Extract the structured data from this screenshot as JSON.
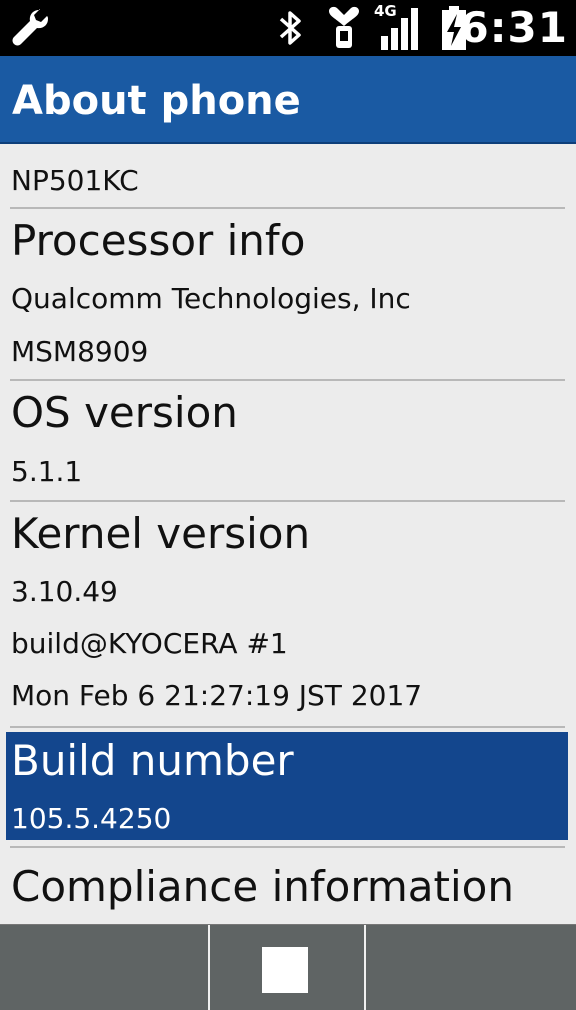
{
  "status_bar": {
    "time": "6:31",
    "network": "4G",
    "icons": [
      "wrench-icon",
      "bluetooth-icon",
      "heart-icon",
      "signal-icon",
      "battery-charging-icon"
    ]
  },
  "action_bar": {
    "title": "About phone"
  },
  "items": {
    "model": {
      "line1": "NP501KC"
    },
    "processor": {
      "title": "Processor info",
      "line1": "Qualcomm Technologies, Inc",
      "line2": "MSM8909"
    },
    "os": {
      "title": "OS version",
      "line1": "5.1.1"
    },
    "kernel": {
      "title": "Kernel version",
      "line1": "3.10.49",
      "line2": "build@KYOCERA #1",
      "line3": "Mon Feb 6 21:27:19 JST 2017"
    },
    "build": {
      "title": "Build number",
      "line1": "105.5.4250",
      "selected": true
    },
    "compliance": {
      "title": "Compliance information"
    }
  },
  "nav_bar": {
    "keys": [
      "left-soft-key",
      "center-key",
      "right-soft-key"
    ]
  },
  "colors": {
    "action_bar": "#1a5aa3",
    "selected_row": "#13468d",
    "background": "#ececec",
    "nav_bar": "#5f6464"
  }
}
